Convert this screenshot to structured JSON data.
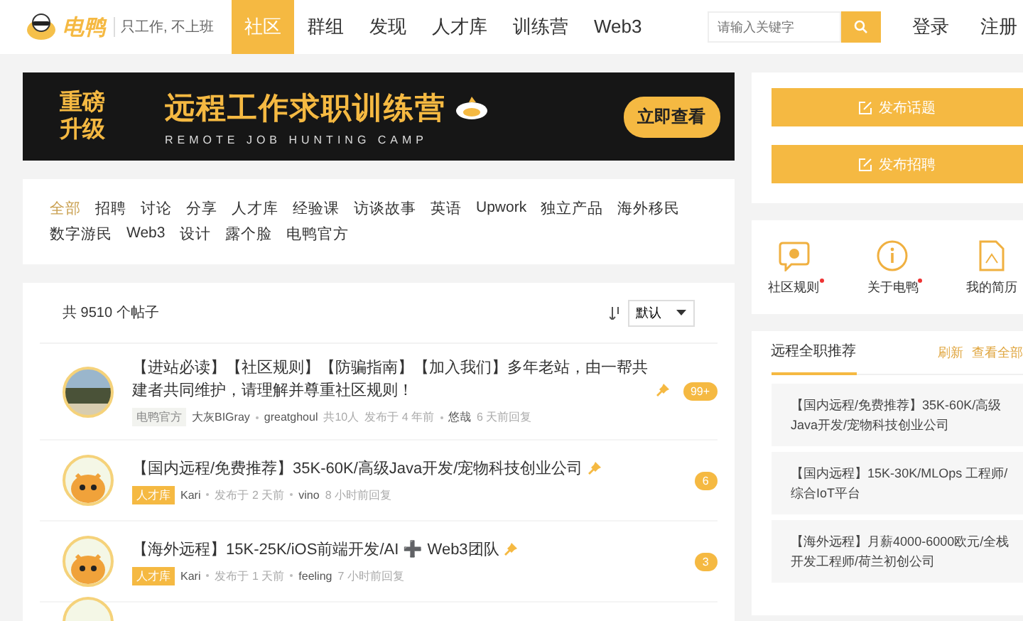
{
  "header": {
    "logo": "电鸭",
    "slogan": "只工作, 不上班",
    "nav": [
      {
        "label": "社区",
        "selected": true
      },
      {
        "label": "群组",
        "selected": false
      },
      {
        "label": "发现",
        "selected": false
      },
      {
        "label": "人才库",
        "selected": false
      },
      {
        "label": "训练营",
        "selected": false
      },
      {
        "label": "Web3",
        "selected": false
      }
    ],
    "search": {
      "placeholder": "请输入关键字"
    },
    "actions": [
      "登录",
      "注册"
    ]
  },
  "banner": {
    "badge_lines": [
      "重磅",
      "升级"
    ],
    "title": "远程工作求职训练营",
    "subtitle": "REMOTE JOB HUNTING CAMP",
    "button": "立即查看"
  },
  "categories": [
    {
      "label": "全部",
      "selected": true
    },
    {
      "label": "招聘",
      "selected": false
    },
    {
      "label": "讨论",
      "selected": false
    },
    {
      "label": "分享",
      "selected": false
    },
    {
      "label": "人才库",
      "selected": false
    },
    {
      "label": "经验课",
      "selected": false
    },
    {
      "label": "访谈故事",
      "selected": false
    },
    {
      "label": "英语",
      "selected": false
    },
    {
      "label": "Upwork",
      "selected": false
    },
    {
      "label": "独立产品",
      "selected": false
    },
    {
      "label": "海外移民",
      "selected": false
    },
    {
      "label": "数字游民",
      "selected": false
    },
    {
      "label": "Web3",
      "selected": false
    },
    {
      "label": "设计",
      "selected": false
    },
    {
      "label": "露个脸",
      "selected": false
    },
    {
      "label": "电鸭官方",
      "selected": false
    }
  ],
  "posts_header": {
    "count": "共 9510 个帖子",
    "sort": "默认"
  },
  "posts": [
    {
      "avatar": {
        "kind": "photo"
      },
      "title": "【进站必读】【社区规则】【防骗指南】【加入我们】多年老站，由一帮共建者共同维护，请理解并尊重社区规则！",
      "pinned": true,
      "tag": {
        "label": "电鸭官方",
        "kind": "official"
      },
      "meta": [
        {
          "kind": "user",
          "text": "大灰BIGray"
        },
        {
          "kind": "user",
          "text": "greatghoul"
        },
        {
          "kind": "info",
          "text": "共10人"
        },
        {
          "kind": "info",
          "text": "发布于 4 年前"
        },
        {
          "kind": "user",
          "text": "悠哉"
        },
        {
          "kind": "info",
          "text": "6 天前回复"
        }
      ],
      "replies": "99+"
    },
    {
      "avatar": {
        "kind": "mascot"
      },
      "title": "【国内远程/免费推荐】35K-60K/高级Java开发/宠物科技创业公司",
      "pinned": true,
      "tag": {
        "label": "人才库",
        "kind": "talent"
      },
      "meta": [
        {
          "kind": "user",
          "text": "Kari"
        },
        {
          "kind": "info",
          "text": "发布于 2 天前"
        },
        {
          "kind": "user",
          "text": "vino"
        },
        {
          "kind": "info",
          "text": "8 小时前回复"
        }
      ],
      "replies": "6"
    },
    {
      "avatar": {
        "kind": "mascot"
      },
      "title": "【海外远程】15K-25K/iOS前端开发/AI ➕ Web3团队",
      "pinned": true,
      "tag": {
        "label": "人才库",
        "kind": "talent"
      },
      "meta": [
        {
          "kind": "user",
          "text": "Kari"
        },
        {
          "kind": "info",
          "text": "发布于 1 天前"
        },
        {
          "kind": "user",
          "text": "feeling"
        },
        {
          "kind": "info",
          "text": "7 小时前回复"
        }
      ],
      "replies": "3"
    }
  ],
  "sidebar": {
    "buttons": [
      "发布话题",
      "发布招聘"
    ],
    "shortcuts": [
      {
        "label": "社区规则",
        "kind": "rules",
        "dot": true
      },
      {
        "label": "关于电鸭",
        "kind": "about",
        "dot": true
      },
      {
        "label": "我的简历",
        "kind": "resume",
        "dot": false
      }
    ],
    "recommend": {
      "title": "远程全职推荐",
      "links": [
        "刷新",
        "查看全部"
      ],
      "items": [
        "【国内远程/免费推荐】35K-60K/高级Java开发/宠物科技创业公司",
        "【国内远程】15K-30K/MLOps 工程师/综合IoT平台",
        "【海外远程】月薪4000-6000欧元/全栈开发工程师/荷兰初创公司"
      ]
    }
  }
}
